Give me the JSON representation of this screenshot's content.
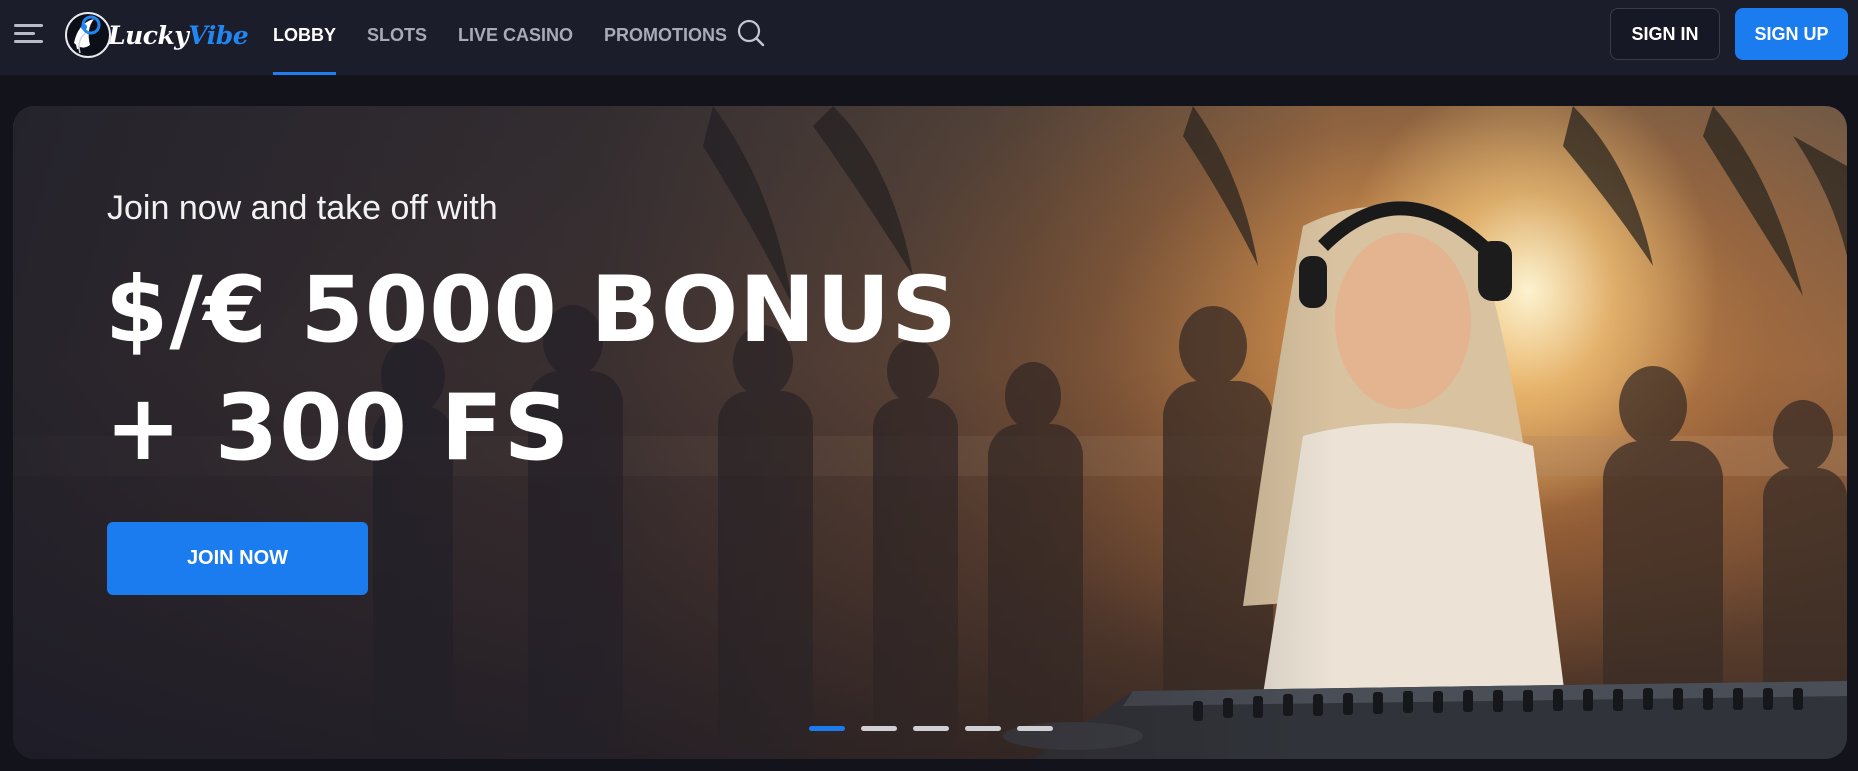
{
  "header": {
    "logo": {
      "word1": "Lucky",
      "word2": "Vibe"
    },
    "nav": [
      {
        "label": "LOBBY",
        "active": true
      },
      {
        "label": "SLOTS",
        "active": false
      },
      {
        "label": "LIVE CASINO",
        "active": false
      },
      {
        "label": "PROMOTIONS",
        "active": false
      }
    ],
    "icons": {
      "menu": "hamburger-menu-icon",
      "search": "search-icon"
    },
    "sign_in_label": "SIGN IN",
    "sign_up_label": "SIGN UP"
  },
  "hero": {
    "kicker": "Join now and take off with",
    "title_line1": "$/€ 5000 BONUS",
    "title_line2": "+ 300 FS",
    "cta_label": "JOIN NOW",
    "slides": {
      "total": 5,
      "active_index": 0
    }
  },
  "colors": {
    "accent": "#1b7cef",
    "header_bg": "#1c1d2b",
    "page_bg": "#13131c",
    "inactive_nav": "#a7abb8"
  }
}
